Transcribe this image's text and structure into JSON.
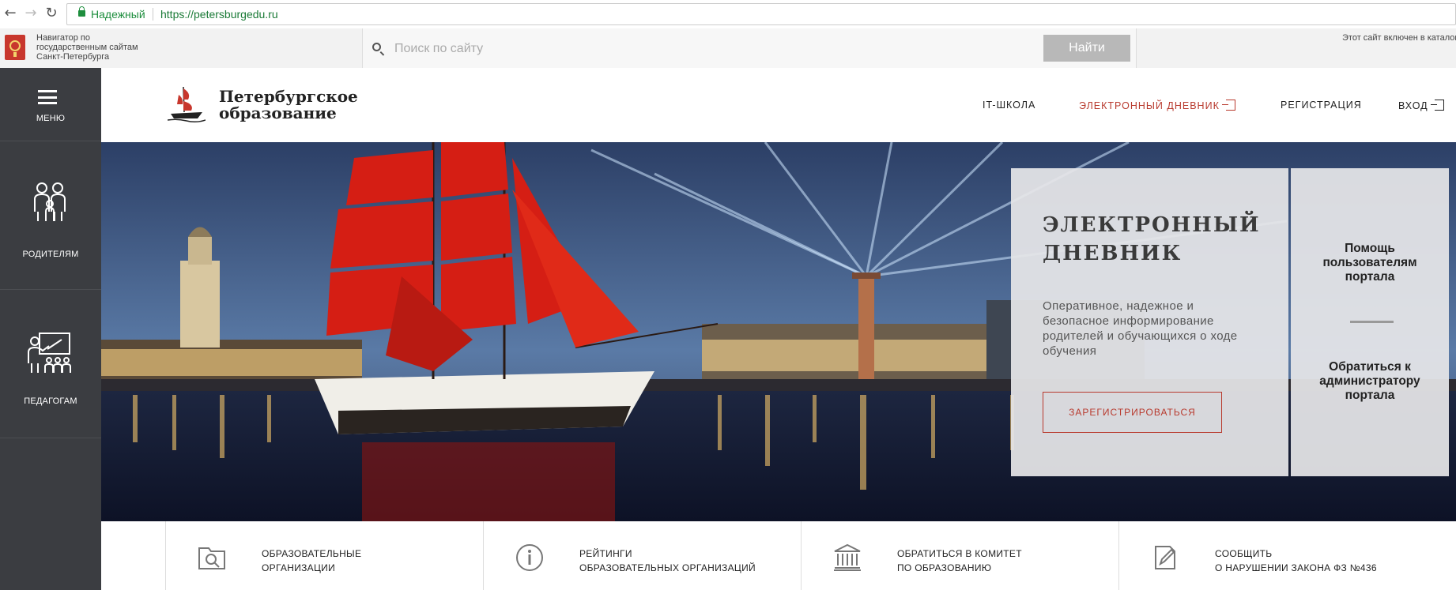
{
  "browser": {
    "secure_label": "Надежный",
    "url": "https://petersburgedu.ru"
  },
  "gov_strip": {
    "navigator_text": "Навигатор по государственным сайтам Санкт-Петербурга",
    "search_placeholder": "Поиск по сайту",
    "search_button": "Найти",
    "catalog_text": "Этот сайт включен в каталог государственных сайтов Санкт-Петербурга"
  },
  "sidebar": {
    "items": [
      {
        "label": "МЕНЮ",
        "icon": "hamburger-icon"
      },
      {
        "label": "РОДИТЕЛЯМ",
        "icon": "family-icon"
      },
      {
        "label": "ПЕДАГОГАМ",
        "icon": "teacher-icon"
      }
    ]
  },
  "header": {
    "brand_line1": "Петербургское",
    "brand_line2": "образование",
    "nav": [
      {
        "label": "IT-ШКОЛА"
      },
      {
        "label": "ЭЛЕКТРОННЫЙ ДНЕВНИК",
        "icon": "login-door-icon"
      },
      {
        "label": "РЕГИСТРАЦИЯ"
      },
      {
        "label": "ВХОД",
        "icon": "login-door-icon"
      }
    ]
  },
  "hero": {
    "title_line1": "ЭЛЕКТРОННЫЙ",
    "title_line2": "ДНЕВНИК",
    "description": "Оперативное, надежное и безопасное информирование родителей и обучающихся о ходе обучения",
    "register_button": "ЗАРЕГИСТРИРОВАТЬСЯ",
    "help_link": "Помощь пользователям портала",
    "admin_link": "Обратиться к администратору портала"
  },
  "quick_links": [
    {
      "line1": "ОБРАЗОВАТЕЛЬНЫЕ",
      "line2": "ОРГАНИЗАЦИИ",
      "icon": "folder-search-icon"
    },
    {
      "line1": "РЕЙТИНГИ",
      "line2": "ОБРАЗОВАТЕЛЬНЫХ ОРГАНИЗАЦИЙ",
      "icon": "info-icon"
    },
    {
      "line1": "ОБРАТИТЬСЯ В КОМИТЕТ",
      "line2": "ПО ОБРАЗОВАНИЮ",
      "icon": "institution-icon"
    },
    {
      "line1": "СООБЩИТЬ",
      "line2": "О НАРУШЕНИИ ЗАКОНА ФЗ №436",
      "icon": "report-document-icon"
    }
  ],
  "colors": {
    "accent_red": "#b83a2e",
    "sidebar_bg": "#3b3d41",
    "secure_green": "#1e8e3e"
  }
}
